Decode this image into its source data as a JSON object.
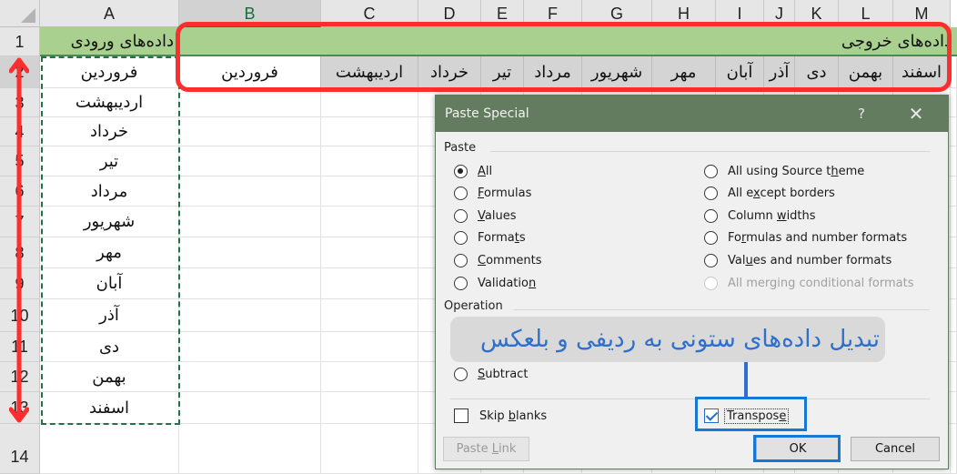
{
  "spreadsheet": {
    "columns": [
      "A",
      "B",
      "C",
      "D",
      "E",
      "F",
      "G",
      "H",
      "I",
      "J",
      "K",
      "L",
      "M"
    ],
    "selected_column": "B",
    "rows": [
      "1",
      "2",
      "3",
      "4",
      "5",
      "6",
      "7",
      "8",
      "9",
      "10",
      "11",
      "12",
      "13",
      "14"
    ],
    "input_header": "داده‌های ورودی",
    "output_header": "داده‌های خروجی",
    "input_values": [
      "فروردین",
      "اردیبهشت",
      "خرداد",
      "تیر",
      "مرداد",
      "شهریور",
      "مهر",
      "آبان",
      "آذر",
      "دی",
      "بهمن",
      "اسفند"
    ],
    "output_values": [
      "فروردین",
      "اردیبهشت",
      "خرداد",
      "تیر",
      "مرداد",
      "شهریور",
      "مهر",
      "آبان",
      "آذر",
      "دی",
      "بهمن",
      "اسفند"
    ]
  },
  "dialog": {
    "title": "Paste Special",
    "help_label": "?",
    "close_label": "✕",
    "paste_group_label": "Paste",
    "paste_options_left": [
      {
        "pre": "",
        "key": "A",
        "post": "ll",
        "checked": true
      },
      {
        "pre": "",
        "key": "F",
        "post": "ormulas",
        "checked": false
      },
      {
        "pre": "",
        "key": "V",
        "post": "alues",
        "checked": false
      },
      {
        "pre": "Forma",
        "key": "t",
        "post": "s",
        "checked": false
      },
      {
        "pre": "",
        "key": "C",
        "post": "omments",
        "checked": false
      },
      {
        "pre": "Validatio",
        "key": "n",
        "post": "",
        "checked": false
      }
    ],
    "paste_options_right": [
      {
        "pre": "All using Source t",
        "key": "h",
        "post": "eme",
        "checked": false,
        "disabled": false
      },
      {
        "pre": "All e",
        "key": "x",
        "post": "cept borders",
        "checked": false,
        "disabled": false
      },
      {
        "pre": "Column ",
        "key": "w",
        "post": "idths",
        "checked": false,
        "disabled": false
      },
      {
        "pre": "Fo",
        "key": "r",
        "post": "mulas and number formats",
        "checked": false,
        "disabled": false
      },
      {
        "pre": "Val",
        "key": "u",
        "post": "es and number formats",
        "checked": false,
        "disabled": false
      },
      {
        "pre": "All mer",
        "key": "g",
        "post": "ing conditional formats",
        "checked": false,
        "disabled": true
      }
    ],
    "operation_group_label": "Operation",
    "operation_visible_option": {
      "pre": "",
      "key": "S",
      "post": "ubtract",
      "checked": false
    },
    "skip_blanks": {
      "pre": "Skip ",
      "key": "b",
      "post": "lanks",
      "checked": false
    },
    "transpose": {
      "pre": "Transpos",
      "key": "e",
      "post": "",
      "checked": true
    },
    "paste_link_label": {
      "pre": "Paste ",
      "key": "L",
      "post": "ink"
    },
    "ok_label": "OK",
    "cancel_label": "Cancel"
  },
  "annotation": {
    "callout_text": "تبدیل داده‌های ستونی به ردیفی و بلعکس",
    "callout_color": "#2f6fcc",
    "highlight_color": "#ff2d2d",
    "focus_color": "#1478d4"
  }
}
